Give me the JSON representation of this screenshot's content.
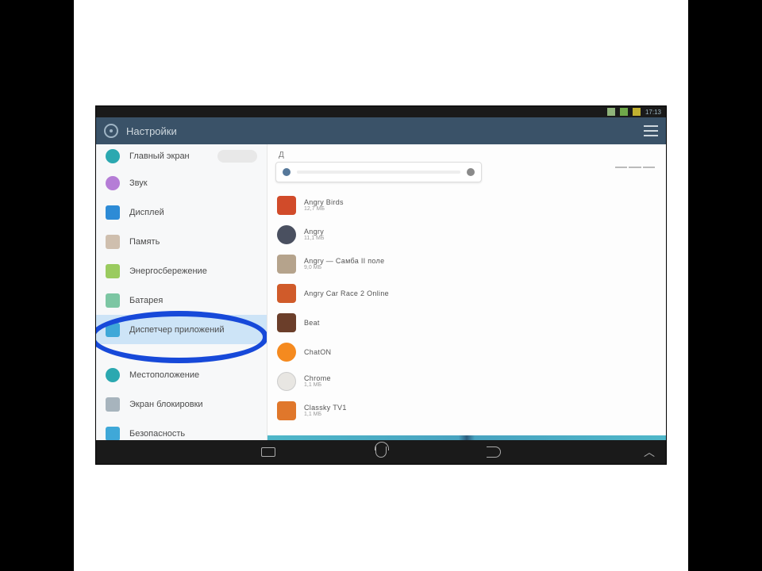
{
  "status": {
    "time": "17:13"
  },
  "title_bar": {
    "title": "Настройки"
  },
  "sidebar": {
    "items": [
      {
        "label": "Главный экран",
        "icon": "teal"
      },
      {
        "label": "Звук",
        "icon": "purple"
      },
      {
        "label": "Дисплей",
        "icon": "blue"
      },
      {
        "label": "Память",
        "icon": "grayb"
      },
      {
        "label": "Энергосбережение",
        "icon": "green"
      },
      {
        "label": "Батарея",
        "icon": "tealgn"
      },
      {
        "label": "Диспетчер приложений",
        "icon": "cyanb"
      },
      {
        "label": "Местоположение",
        "icon": "teal"
      },
      {
        "label": "Экран блокировки",
        "icon": "gray"
      },
      {
        "label": "Безопасность",
        "icon": "cyanb"
      }
    ],
    "selected_index": 6
  },
  "main": {
    "tab_letter": "Д",
    "apps": [
      {
        "name": "Angry Birds",
        "sub": "12,7 МБ",
        "color": "#d14b2a"
      },
      {
        "name": "Angry",
        "sub": "11,1 МБ",
        "color": "#4a5060"
      },
      {
        "name": "Angry — Самба II поле",
        "sub": "9,0 МБ",
        "color": "#b5a38c"
      },
      {
        "name": "Angry Car Race 2 Online",
        "sub": "",
        "color": "#d05b2a"
      },
      {
        "name": "Beat",
        "sub": "",
        "color": "#6b3e2a"
      },
      {
        "name": "ChatON",
        "sub": "",
        "color": "#f58a1f"
      },
      {
        "name": "Chrome",
        "sub": "1,1 МБ",
        "color": "#e8e6e2"
      },
      {
        "name": "Classky TV1",
        "sub": "1,1 МБ",
        "color": "#e0772b"
      }
    ]
  }
}
